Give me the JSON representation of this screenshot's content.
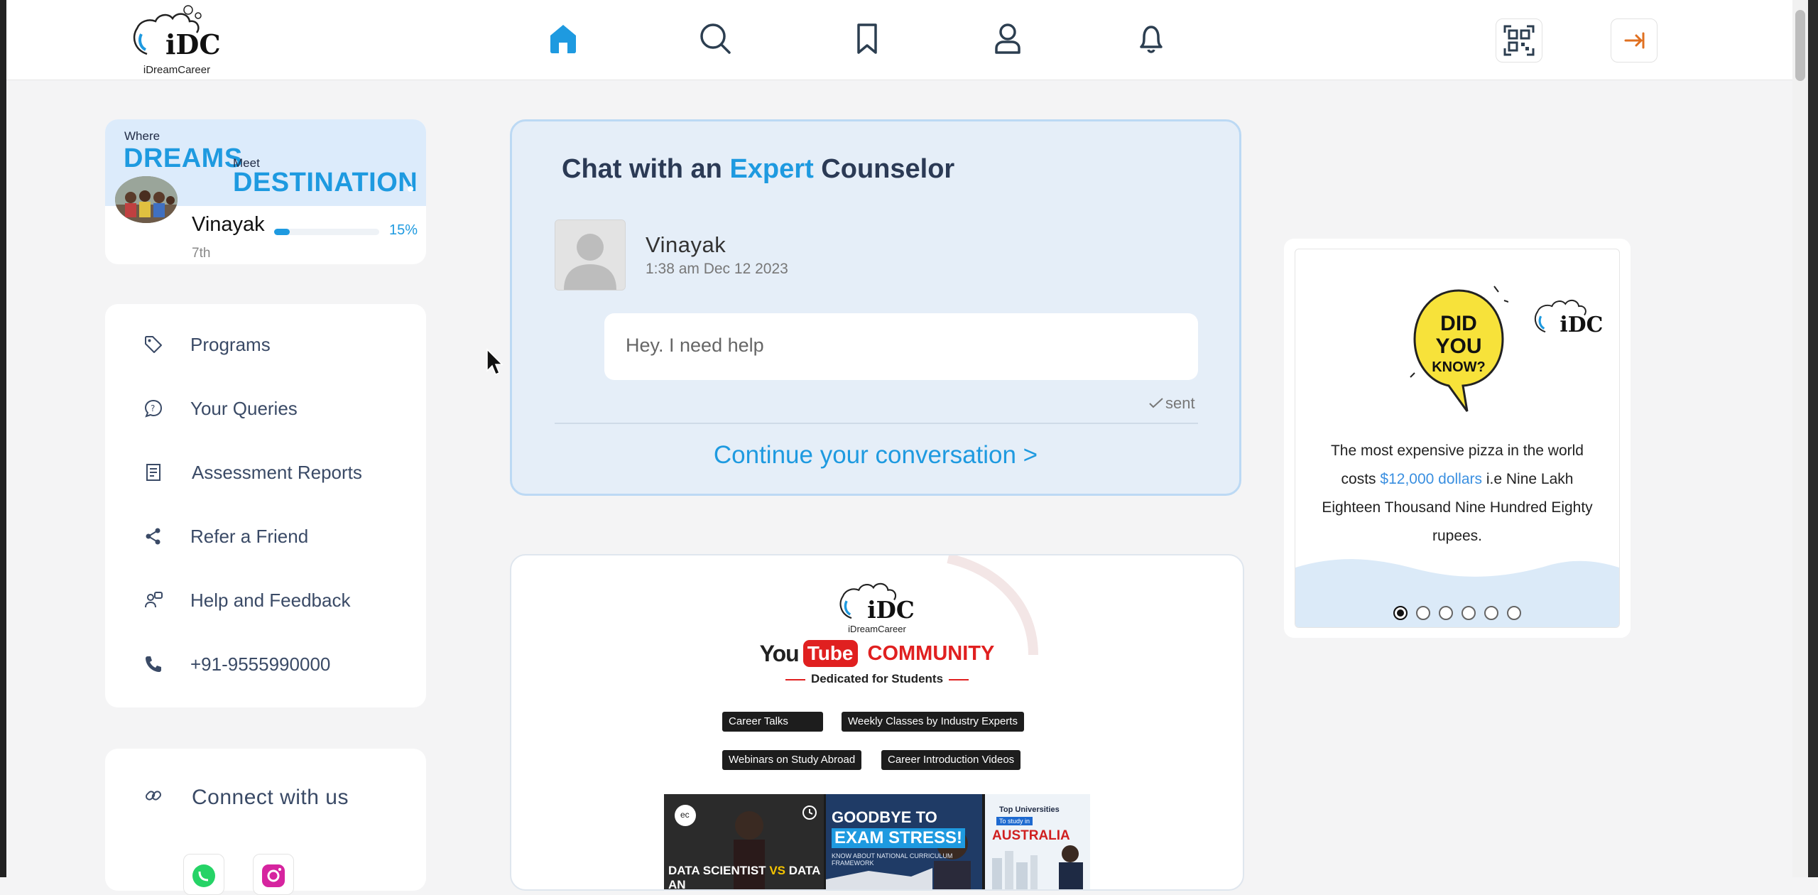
{
  "header": {
    "logo_caption": "iDreamCareer",
    "logo_text": "iDC",
    "nav": [
      {
        "name": "home",
        "icon": "home-icon",
        "active": true
      },
      {
        "name": "search",
        "icon": "search-icon",
        "active": false
      },
      {
        "name": "saved",
        "icon": "bookmark-icon",
        "active": false
      },
      {
        "name": "profile",
        "icon": "user-icon",
        "active": false
      },
      {
        "name": "notifications",
        "icon": "bell-icon",
        "active": false
      }
    ],
    "right_buttons": [
      {
        "name": "qr-code",
        "icon": "qr-code-icon"
      },
      {
        "name": "logout",
        "icon": "logout-icon"
      }
    ]
  },
  "profile": {
    "banner_where": "Where",
    "banner_dreams": "DREAMS",
    "banner_meet": "Meet",
    "banner_destination": "DESTINATION",
    "name": "Vinayak",
    "grade": "7th",
    "progress_label": "15%",
    "progress_fraction": 0.15
  },
  "menu": {
    "items": [
      {
        "label": "Programs",
        "icon": "tag-icon"
      },
      {
        "label": "Your Queries",
        "icon": "question-bubble-icon"
      },
      {
        "label": "Assessment Reports",
        "icon": "report-icon"
      },
      {
        "label": "Refer a Friend",
        "icon": "share-icon"
      },
      {
        "label": "Help and Feedback",
        "icon": "help-feedback-icon"
      },
      {
        "label": "+91-9555990000",
        "icon": "phone-icon"
      }
    ]
  },
  "connect": {
    "label": "Connect with us",
    "icon": "link-icon",
    "socials": [
      "whatsapp-icon",
      "instagram-icon"
    ]
  },
  "chat": {
    "title_pre": "Chat with an",
    "title_accent": "Expert",
    "title_post": "Counselor",
    "sender": "Vinayak",
    "timestamp": "1:38 am Dec 12 2023",
    "message": "Hey. I need help",
    "status": "sent",
    "cta": "Continue your conversation >"
  },
  "community": {
    "logo_caption": "iDreamCareer",
    "logo_text": "iDC",
    "yt_you": "You",
    "yt_tube": "Tube",
    "yt_community": "COMMUNITY",
    "dedicated": "Dedicated for Students",
    "tags": [
      "Career Talks",
      "Weekly Classes by Industry Experts",
      "Webinars on Study Abroad",
      "Career Introduction Videos"
    ],
    "thumb1_a": "DATA SCIENTIST",
    "thumb1_vs": "VS",
    "thumb1_b": "DATA AN",
    "thumb1_badge": "ec",
    "thumb2_a": "GOODBYE TO",
    "thumb2_b": "EXAM STRESS!",
    "thumb2_c": "KNOW ABOUT NATIONAL CURRICULUM FRAMEWORK",
    "thumb3_a": "Top Universities",
    "thumb3_b": "To study in",
    "thumb3_c": "AUSTRALIA"
  },
  "did_you_know": {
    "bubble_l1": "DID",
    "bubble_l2": "YOU",
    "bubble_l3": "KNOW?",
    "logo_text": "iDC",
    "fact_pre": "The most expensive pizza in the world costs",
    "fact_highlight": "$12,000 dollars",
    "fact_post": "i.e Nine Lakh Eighteen Thousand Nine Hundred Eighty rupees.",
    "slide_count": 6,
    "active_slide": 1
  },
  "colors": {
    "accent": "#1e9ae0",
    "logout": "#e07020",
    "youtube_red": "#e02020",
    "dyk_yellow": "#f7e23a"
  }
}
